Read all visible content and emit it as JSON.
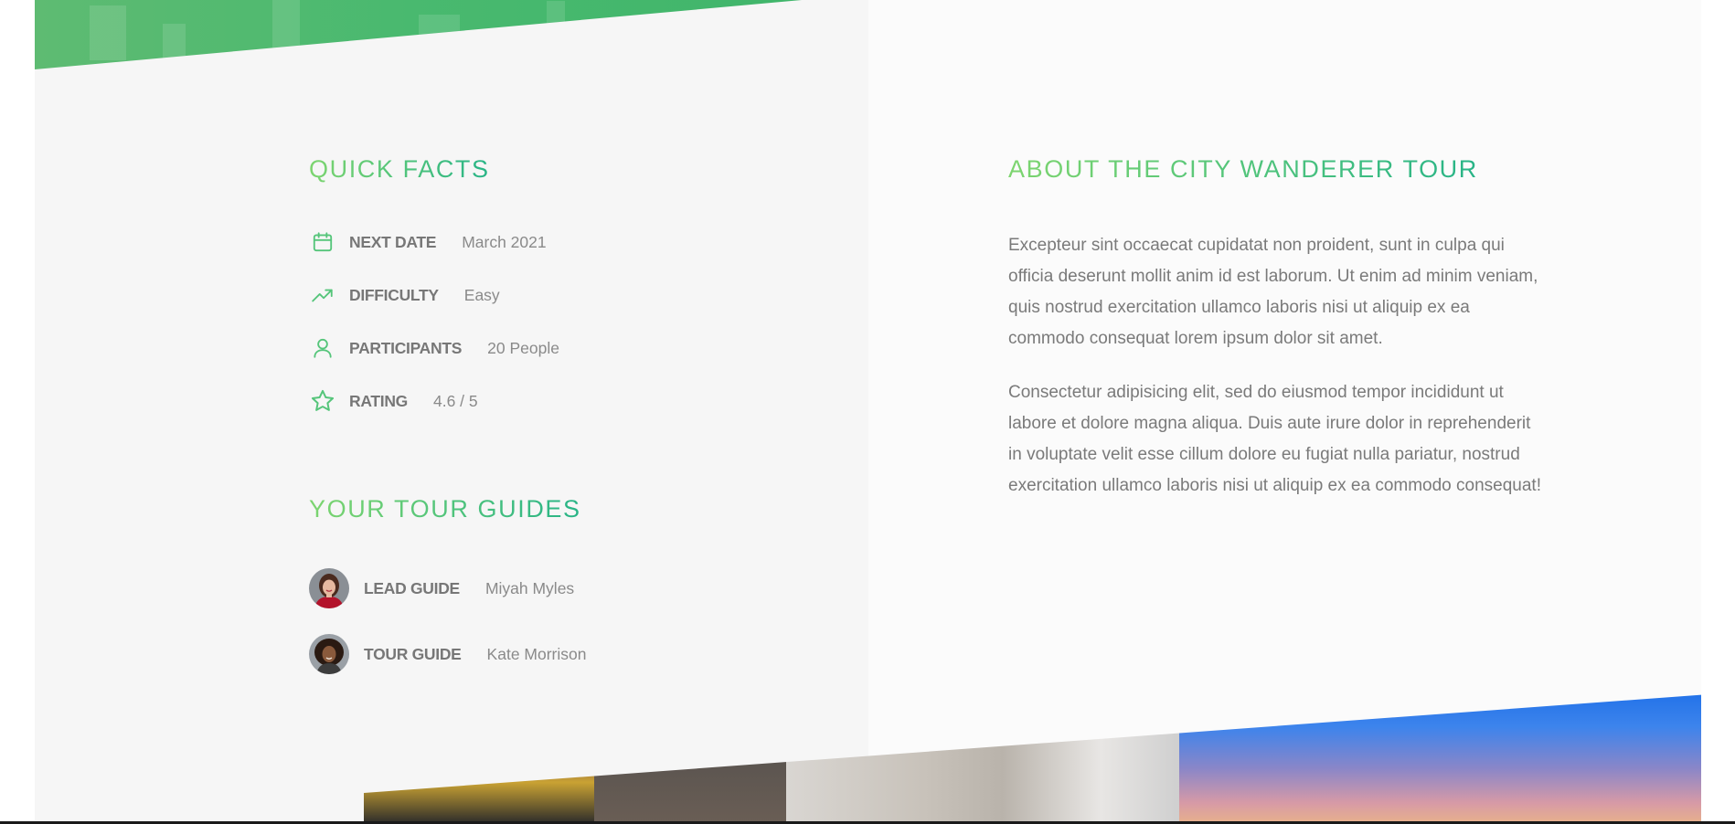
{
  "colors": {
    "accent_start": "#7dd56f",
    "accent_end": "#28b487",
    "text_label": "#777777",
    "text_body": "#7a7a7a",
    "bg_left": "#f6f6f6",
    "bg_right": "#fbfbfb"
  },
  "quick_facts": {
    "heading": "QUICK FACTS",
    "items": [
      {
        "icon": "calendar-icon",
        "label": "NEXT DATE",
        "value": "March 2021"
      },
      {
        "icon": "trending-up-icon",
        "label": "DIFFICULTY",
        "value": "Easy"
      },
      {
        "icon": "user-icon",
        "label": "PARTICIPANTS",
        "value": "20 People"
      },
      {
        "icon": "star-icon",
        "label": "RATING",
        "value": "4.6 / 5"
      }
    ]
  },
  "guides": {
    "heading": "YOUR TOUR GUIDES",
    "items": [
      {
        "icon": "avatar",
        "label": "LEAD GUIDE",
        "value": "Miyah Myles"
      },
      {
        "icon": "avatar",
        "label": "TOUR GUIDE",
        "value": "Kate Morrison"
      }
    ]
  },
  "about": {
    "heading": "ABOUT THE CITY WANDERER TOUR",
    "paragraphs": [
      "Excepteur sint occaecat cupidatat non proident, sunt in culpa qui officia deserunt mollit anim id est laborum. Ut enim ad minim veniam, quis nostrud exercitation ullamco laboris nisi ut aliquip ex ea commodo consequat lorem ipsum dolor sit amet.",
      "Consectetur adipisicing elit, sed do eiusmod tempor incididunt ut labore et dolore magna aliqua. Duis aute irure dolor in reprehenderit in voluptate velit esse cillum dolore eu fugiat nulla pariatur, nostrud exercitation ullamco laboris nisi ut aliquip ex ea commodo consequat!"
    ]
  }
}
